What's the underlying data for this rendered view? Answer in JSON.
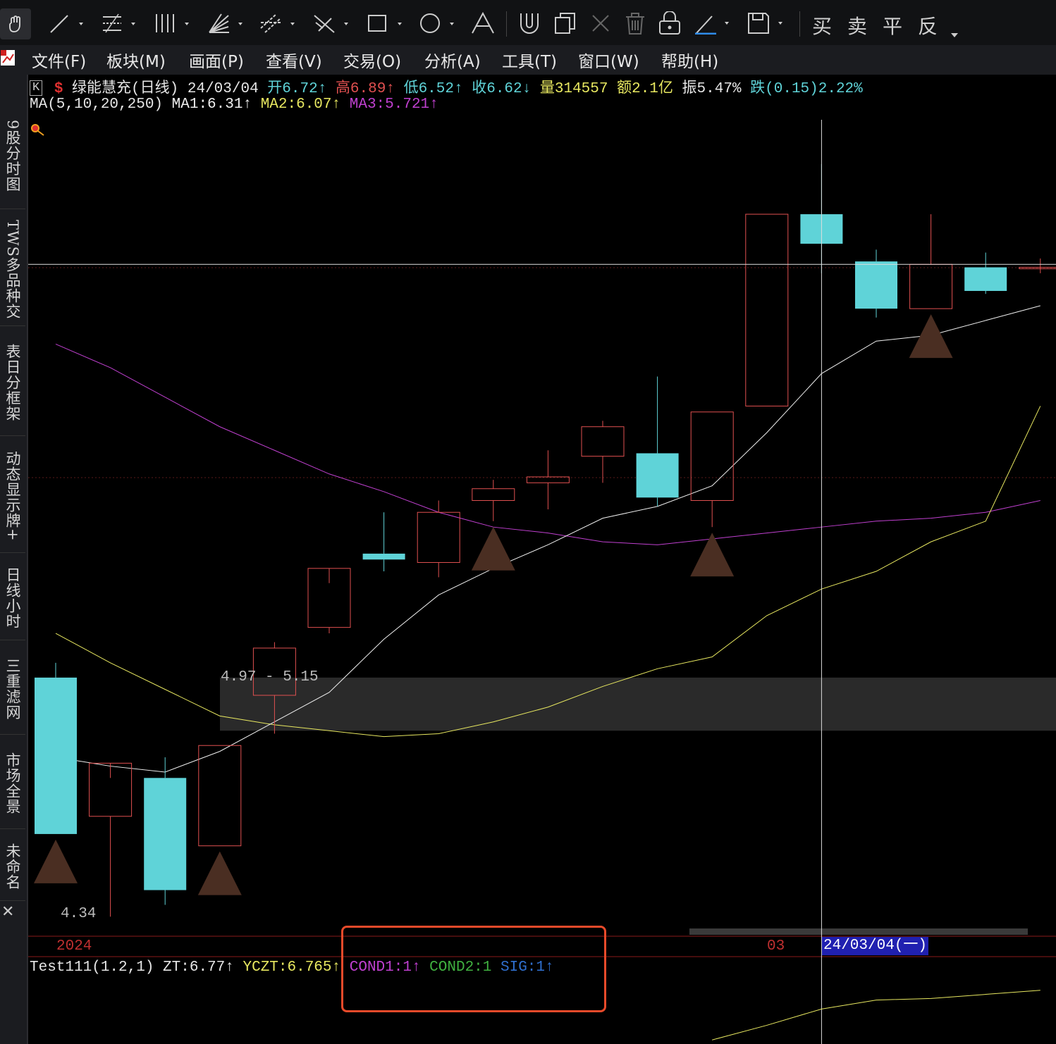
{
  "toolbar": {
    "tools": [
      "hand-icon",
      "line-icon",
      "fib-icon",
      "parallel-lines-icon",
      "fan-icon",
      "channel-icon",
      "cross-lines-icon",
      "rectangle-icon",
      "circle-icon",
      "text-icon",
      "magnet-icon",
      "copy-icon",
      "delete-x-icon",
      "trash-icon",
      "lock-icon",
      "pen-icon",
      "save-icon"
    ],
    "trade_buttons": [
      "买",
      "卖",
      "平",
      "反"
    ]
  },
  "menu": [
    "文件(F)",
    "板块(M)",
    "画面(P)",
    "查看(V)",
    "交易(O)",
    "分析(A)",
    "工具(T)",
    "窗口(W)",
    "帮助(H)"
  ],
  "side_tabs": [
    "9股分时图",
    "TWS多品种交",
    "表日分框架",
    "动态显示牌+",
    "日线小时",
    "三重滤网",
    "市场全景",
    "未命名"
  ],
  "header": {
    "k_badge": "K",
    "s_badge": "$",
    "name": "绿能慧充(日线)",
    "date": "24/03/04",
    "open": "开6.72",
    "high": "高6.89",
    "low": "低6.52",
    "close": "收6.62",
    "volume": "量314557",
    "amount": "额2.1亿",
    "amplitude": "振5.47%",
    "change": "跌(0.15)2.22%",
    "up_arrow": "↑",
    "down_arrow": "↓"
  },
  "ma_row": {
    "label": "MA(5,10,20,250)",
    "ma1": "MA1:6.31",
    "ma2": "MA2:6.07",
    "ma3": "MA3:5.721"
  },
  "indicator_row": {
    "label": "Test111(1.2,1)",
    "zt": "ZT:6.77",
    "yczt": "YCZT:6.765",
    "cond1": "COND1:1",
    "cond2": "COND2:1",
    "sig": "SIG:1"
  },
  "annotations": {
    "zone_label": "4.97 - 5.15",
    "low_label": "4.34"
  },
  "time_axis": {
    "year": "2024",
    "month": "03",
    "cursor_date": "24/03/04(一)"
  },
  "colors": {
    "up": "#e05050",
    "down": "#5fd3d8",
    "ma1": "#f0f0f0",
    "ma2": "#e8e860",
    "ma3": "#c040d0",
    "signal": "#4a2e22",
    "highlight": "#e84a2a"
  },
  "chart_data": {
    "type": "candlestick",
    "dates_note": "",
    "candles": [
      {
        "o": 5.15,
        "h": 5.2,
        "l": 4.62,
        "c": 4.62
      },
      {
        "o": 4.68,
        "h": 4.81,
        "l": 4.34,
        "c": 4.86
      },
      {
        "o": 4.81,
        "h": 4.88,
        "l": 4.38,
        "c": 4.43
      },
      {
        "o": 4.58,
        "h": 4.92,
        "l": 4.58,
        "c": 4.92
      },
      {
        "o": 5.09,
        "h": 5.27,
        "l": 4.96,
        "c": 5.25
      },
      {
        "o": 5.32,
        "h": 5.47,
        "l": 5.3,
        "c": 5.52
      },
      {
        "o": 5.57,
        "h": 5.71,
        "l": 5.51,
        "c": 5.55
      },
      {
        "o": 5.54,
        "h": 5.75,
        "l": 5.49,
        "c": 5.71
      },
      {
        "o": 5.75,
        "h": 5.82,
        "l": 5.68,
        "c": 5.79
      },
      {
        "o": 5.81,
        "h": 5.92,
        "l": 5.72,
        "c": 5.83
      },
      {
        "o": 5.9,
        "h": 6.02,
        "l": 5.81,
        "c": 6.0
      },
      {
        "o": 5.91,
        "h": 6.17,
        "l": 5.73,
        "c": 5.76
      },
      {
        "o": 5.75,
        "h": 6.05,
        "l": 5.66,
        "c": 6.05
      },
      {
        "o": 6.07,
        "h": 6.72,
        "l": 6.07,
        "c": 6.72
      },
      {
        "o": 6.72,
        "h": 6.89,
        "l": 6.52,
        "c": 6.62
      },
      {
        "o": 6.56,
        "h": 6.6,
        "l": 6.37,
        "c": 6.4
      },
      {
        "o": 6.4,
        "h": 6.72,
        "l": 6.4,
        "c": 6.55
      },
      {
        "o": 6.54,
        "h": 6.59,
        "l": 6.45,
        "c": 6.46
      },
      {
        "o": 6.54,
        "h": 6.57,
        "l": 6.52,
        "c": 6.54
      }
    ],
    "ma1": [
      4.88,
      4.85,
      4.83,
      4.9,
      5.0,
      5.1,
      5.28,
      5.43,
      5.52,
      5.6,
      5.69,
      5.73,
      5.8,
      5.98,
      6.18,
      6.29,
      6.31,
      6.36,
      6.41
    ],
    "ma2": [
      5.3,
      5.2,
      5.11,
      5.02,
      4.99,
      4.97,
      4.95,
      4.96,
      5.0,
      5.05,
      5.12,
      5.18,
      5.22,
      5.36,
      5.45,
      5.51,
      5.61,
      5.68,
      6.07
    ],
    "ma3": [
      6.28,
      6.2,
      6.1,
      6.0,
      5.92,
      5.84,
      5.78,
      5.71,
      5.66,
      5.64,
      5.61,
      5.6,
      5.62,
      5.64,
      5.66,
      5.68,
      5.69,
      5.71,
      5.75
    ],
    "signals": [
      0,
      3,
      8,
      12,
      16
    ],
    "zone": [
      4.97,
      5.15
    ],
    "yrange": [
      4.3,
      7.04
    ],
    "cursor_index": 14,
    "cursor_price": 6.55
  }
}
